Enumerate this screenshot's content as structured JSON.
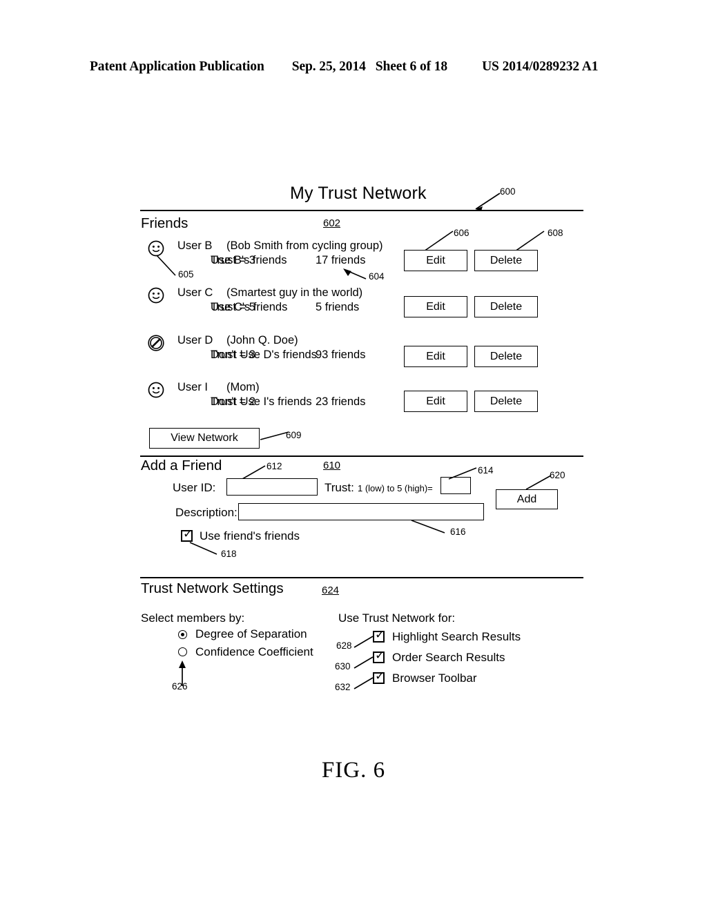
{
  "page_header": {
    "publication": "Patent Application Publication",
    "date": "Sep. 25, 2014",
    "sheet": "Sheet 6 of 18",
    "patent_number": "US 2014/0289232 A1"
  },
  "figure": {
    "caption": "FIG. 6",
    "title": "My Trust Network",
    "title_ref": "600"
  },
  "friends_section": {
    "heading": "Friends",
    "ref": "602",
    "icon_ref": "605",
    "friends_count_ref": "604",
    "edit_ref": "606",
    "delete_ref": "608",
    "view_network_ref": "609",
    "view_network_label": "View Network",
    "rows": [
      {
        "icon": "smiley-icon",
        "name": "User B",
        "description": "(Bob Smith from cycling group)",
        "trust": "Trust = 3",
        "friends": "17 friends",
        "use_friends": "Use B's friends",
        "edit_label": "Edit",
        "delete_label": "Delete"
      },
      {
        "icon": "smiley-icon",
        "name": "User C",
        "description": "(Smartest guy in the world)",
        "trust": "Trust = 5",
        "friends": "5 friends",
        "use_friends": "Use C's friends",
        "edit_label": "Edit",
        "delete_label": "Delete"
      },
      {
        "icon": "prohibited-icon",
        "name": "User D",
        "description": "(John Q. Doe)",
        "trust": "Trust = 3",
        "friends": "93 friends",
        "use_friends": "Don't Use D's friends",
        "edit_label": "Edit",
        "delete_label": "Delete"
      },
      {
        "icon": "smiley-icon",
        "name": "User I",
        "description": "(Mom)",
        "trust": "Trust = 2",
        "friends": "23 friends",
        "use_friends": "Don't Use I's friends",
        "edit_label": "Edit",
        "delete_label": "Delete"
      }
    ]
  },
  "add_friend_section": {
    "heading": "Add a Friend",
    "ref": "610",
    "user_id_label": "User ID:",
    "user_id_value": "",
    "user_id_ref": "612",
    "trust_label": "Trust:",
    "trust_range_label": "1 (low) to 5 (high)=",
    "trust_value": "",
    "trust_ref": "614",
    "description_label": "Description:",
    "description_value": "",
    "description_ref": "616",
    "use_friends_label": "Use friend's friends",
    "use_friends_checked": true,
    "use_friends_ref": "618",
    "add_label": "Add",
    "add_ref": "620"
  },
  "settings_section": {
    "heading": "Trust Network Settings",
    "ref": "624",
    "select_members_label": "Select members by:",
    "select_members_ref": "626",
    "radio_options": [
      {
        "label": "Degree of Separation",
        "selected": true
      },
      {
        "label": "Confidence Coefficient",
        "selected": false
      }
    ],
    "use_for_label": "Use Trust Network for:",
    "checkbox_options": [
      {
        "label": "Highlight Search Results",
        "checked": true,
        "ref": "628"
      },
      {
        "label": "Order Search Results",
        "checked": true,
        "ref": "630"
      },
      {
        "label": "Browser Toolbar",
        "checked": true,
        "ref": "632"
      }
    ]
  },
  "glyphs": {
    "check": "✓"
  }
}
